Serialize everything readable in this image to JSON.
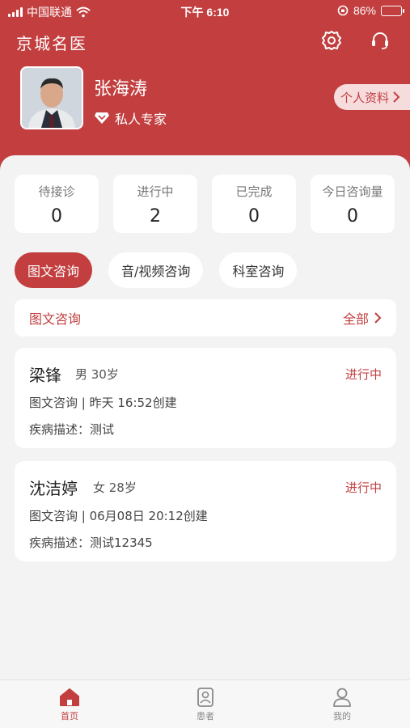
{
  "status_bar": {
    "carrier": "中国联通",
    "time": "下午 6:10",
    "battery": "86%",
    "battery_level": 0.86
  },
  "header": {
    "logo": "京城名医",
    "icons": [
      "gear-icon",
      "headset-icon"
    ]
  },
  "doctor": {
    "name": "张海涛",
    "tag": "私人专家",
    "profile_button": "个人资料"
  },
  "stats": [
    {
      "label": "待接诊",
      "value": "0"
    },
    {
      "label": "进行中",
      "value": "2"
    },
    {
      "label": "已完成",
      "value": "0"
    },
    {
      "label": "今日咨询量",
      "value": "0"
    }
  ],
  "tabs": [
    {
      "label": "图文咨询",
      "active": true
    },
    {
      "label": "音/视频咨询",
      "active": false
    },
    {
      "label": "科室咨询",
      "active": false
    }
  ],
  "section": {
    "title": "图文咨询",
    "all_label": "全部"
  },
  "consultations": [
    {
      "name": "梁锋",
      "meta": "男 30岁",
      "status": "进行中",
      "info": "图文咨询 | 昨天 16:52创建",
      "desc": "疾病描述：测试"
    },
    {
      "name": "沈洁婷",
      "meta": "女 28岁",
      "status": "进行中",
      "info": "图文咨询 | 06月08日 20:12创建",
      "desc": "疾病描述：测试12345"
    }
  ],
  "tabbar": [
    {
      "label": "首页",
      "icon": "home-icon",
      "active": true
    },
    {
      "label": "患者",
      "icon": "patient-card-icon",
      "active": false
    },
    {
      "label": "我的",
      "icon": "user-icon",
      "active": false
    }
  ],
  "colors": {
    "brand": "#c23e3f",
    "background": "#f3f3f3",
    "profile_button_bg": "#f6dcdc"
  }
}
